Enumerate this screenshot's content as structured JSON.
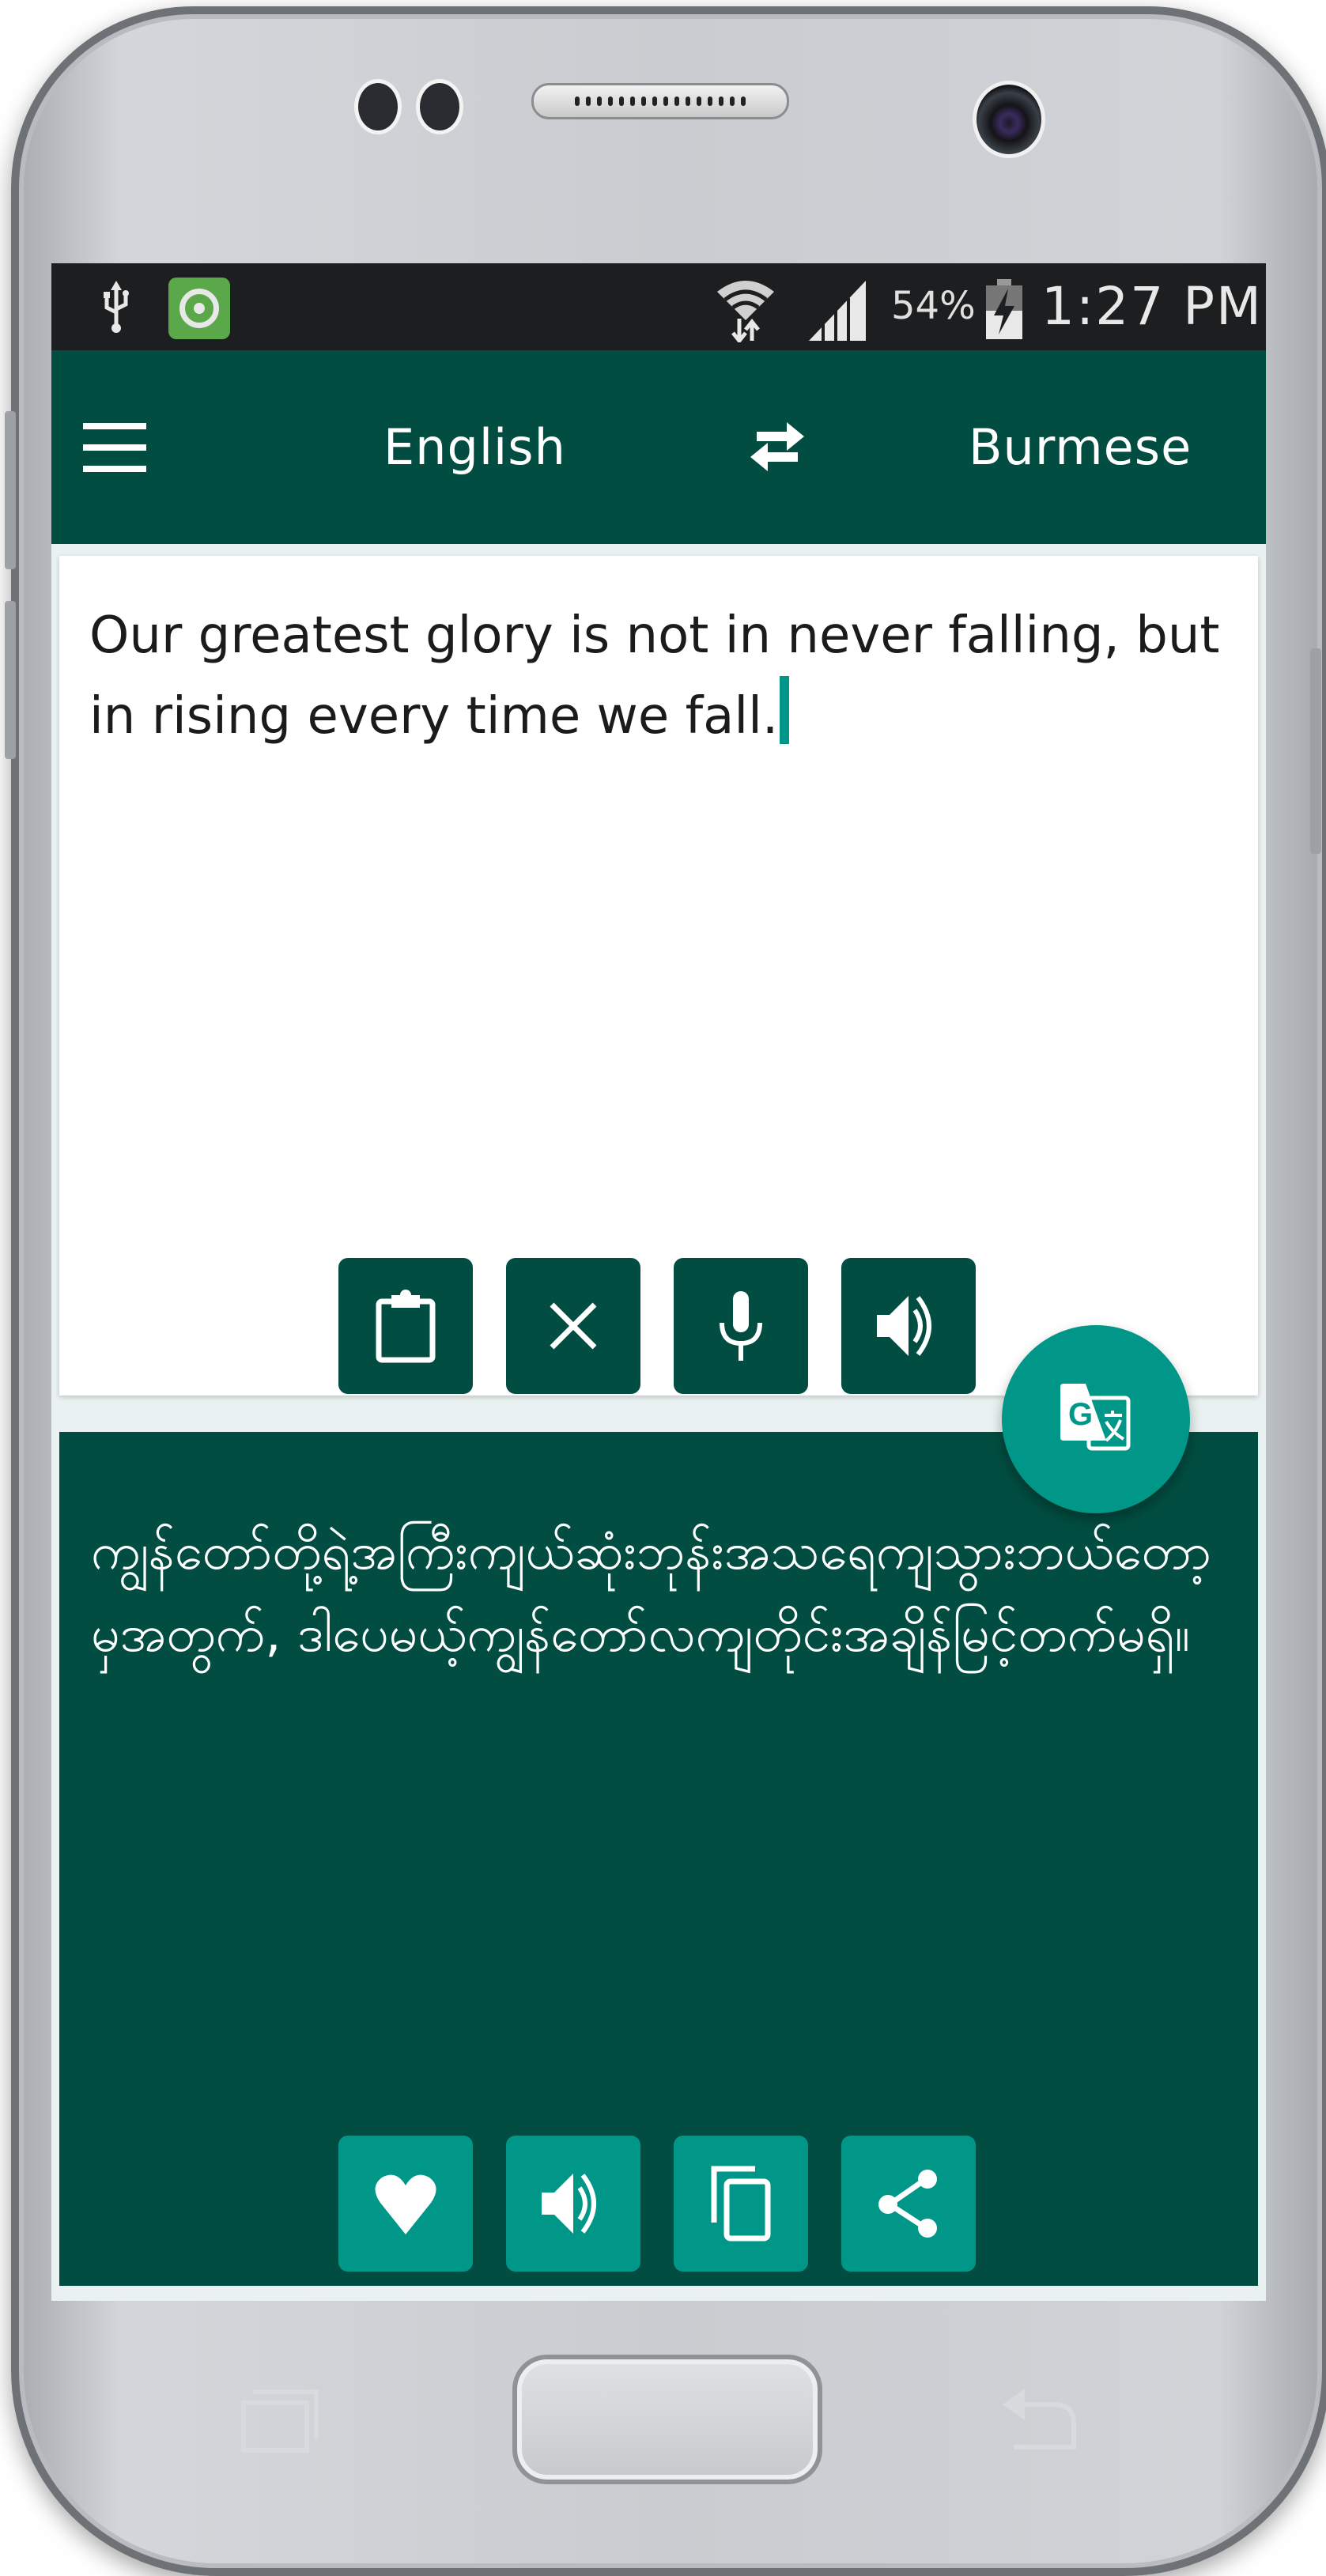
{
  "status_bar": {
    "left_icons": [
      "usb-icon",
      "app-notification-icon"
    ],
    "right_icons": [
      "wifi-icon",
      "signal-icon",
      "battery-charging-icon"
    ],
    "battery": "54%",
    "time": "1:27 PM"
  },
  "toolbar": {
    "menu_icon": "hamburger-menu-icon",
    "source_language": "English",
    "swap_icon": "swap-languages-icon",
    "target_language": "Burmese"
  },
  "input": {
    "text": "Our greatest glory is not in never falling, but in rising every time we fall.",
    "buttons": [
      {
        "name": "paste",
        "icon": "clipboard-icon"
      },
      {
        "name": "clear",
        "icon": "close-icon"
      },
      {
        "name": "voice-input",
        "icon": "microphone-icon"
      },
      {
        "name": "speak-input",
        "icon": "speaker-icon"
      }
    ]
  },
  "translate_fab": {
    "icon": "google-translate-icon"
  },
  "output": {
    "text": "ကျွန်တော်တို့ရဲ့အကြီးကျယ်ဆုံးဘုန်းအသရေကျသွားဘယ်တော့မှအတွက်, ဒါပေမယ့်ကျွန်တော်လကျတိုင်းအချိန်မြင့်တက်မရှိ။",
    "buttons": [
      {
        "name": "favorite",
        "icon": "heart-icon"
      },
      {
        "name": "speak-output",
        "icon": "speaker-icon"
      },
      {
        "name": "copy",
        "icon": "copy-icon"
      },
      {
        "name": "share",
        "icon": "share-icon"
      }
    ]
  },
  "device_keys": [
    "recent-apps-icon",
    "home-button",
    "back-icon"
  ],
  "colors": {
    "primary_dark": "#024d41",
    "accent": "#009688",
    "status_bar": "#1d1e1f"
  }
}
